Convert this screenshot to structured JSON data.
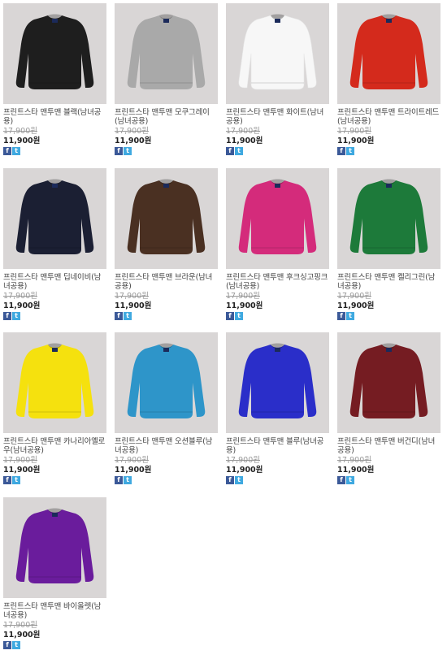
{
  "products": [
    {
      "name": "프린트스타 맨투맨 블랙(남녀공용)",
      "old_price": "17,900원",
      "price": "11,900원",
      "color": "#1e1e1e"
    },
    {
      "name": "프린트스타 맨투맨 모쿠그레이(남녀공용)",
      "old_price": "17,900원",
      "price": "11,900원",
      "color": "#a9a9a9"
    },
    {
      "name": "프린트스타 맨투맨 화이트(남녀공용)",
      "old_price": "17,900원",
      "price": "11,900원",
      "color": "#f7f7f7"
    },
    {
      "name": "프린트스타 맨투맨 트라이트레드(남녀공용)",
      "old_price": "17,900원",
      "price": "11,900원",
      "color": "#d42a1c"
    },
    {
      "name": "프린트스타 맨투맨 딥네이비(남녀공용)",
      "old_price": "17,900원",
      "price": "11,900원",
      "color": "#1b1f33"
    },
    {
      "name": "프린트스타 맨투맨 브라운(남녀공용)",
      "old_price": "17,900원",
      "price": "11,900원",
      "color": "#4a3022"
    },
    {
      "name": "프린트스타 맨투맨 후크싱고핑크(남녀공용)",
      "old_price": "17,900원",
      "price": "11,900원",
      "color": "#d42b7b"
    },
    {
      "name": "프린트스타 맨투맨 켈리그린(남녀공용)",
      "old_price": "17,900원",
      "price": "11,900원",
      "color": "#1d7a3a"
    },
    {
      "name": "프린트스타 맨투맨 카나리아옐로우(남녀공용)",
      "old_price": "17,900원",
      "price": "11,900원",
      "color": "#f5e10e"
    },
    {
      "name": "프린트스타 맨투맨 오션블루(남녀공용)",
      "old_price": "17,900원",
      "price": "11,900원",
      "color": "#2e95c9"
    },
    {
      "name": "프린트스타 맨투맨 블루(남녀공용)",
      "old_price": "17,900원",
      "price": "11,900원",
      "color": "#2a2ec9"
    },
    {
      "name": "프린트스타 맨투맨 버건디(남녀공용)",
      "old_price": "17,900원",
      "price": "11,900원",
      "color": "#751c22"
    },
    {
      "name": "프린트스타 맨투맨 바이올렛(남녀공용)",
      "old_price": "17,900원",
      "price": "11,900원",
      "color": "#6a1c9c"
    }
  ],
  "share": {
    "facebook_icon": "f",
    "twitter_icon": "t"
  },
  "colors": {
    "thumb_bg": "#d9d6d6",
    "facebook": "#3b5998",
    "twitter": "#3fa9e0"
  }
}
